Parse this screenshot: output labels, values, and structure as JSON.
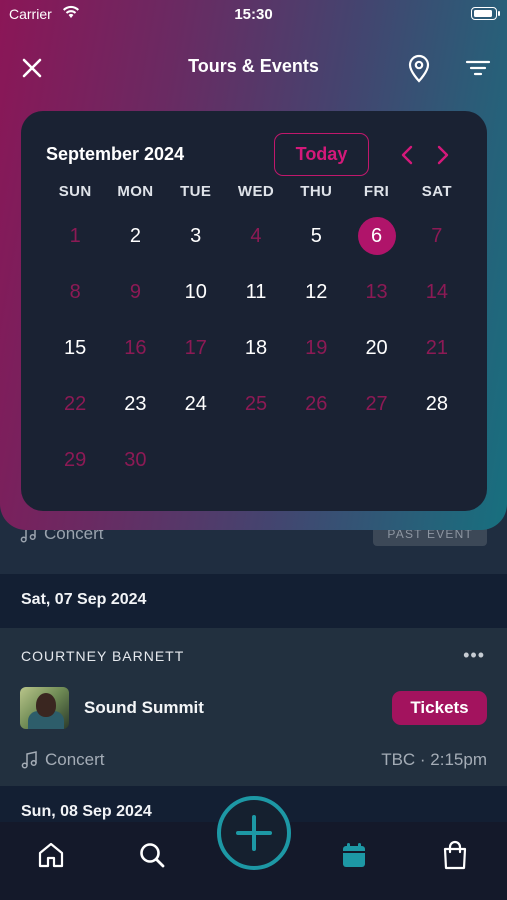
{
  "status_bar": {
    "carrier": "Carrier",
    "time": "15:30"
  },
  "nav": {
    "title": "Tours & Events"
  },
  "calendar": {
    "month_label": "September 2024",
    "today_label": "Today",
    "weekdays": [
      "SUN",
      "MON",
      "TUE",
      "WED",
      "THU",
      "FRI",
      "SAT"
    ],
    "selected_day": "6",
    "days": [
      {
        "d": "1",
        "dim": true
      },
      {
        "d": "2",
        "dim": false
      },
      {
        "d": "3",
        "dim": false
      },
      {
        "d": "4",
        "dim": true
      },
      {
        "d": "5",
        "dim": false
      },
      {
        "d": "6",
        "dim": false,
        "selected": true
      },
      {
        "d": "7",
        "dim": true
      },
      {
        "d": "8",
        "dim": true
      },
      {
        "d": "9",
        "dim": true
      },
      {
        "d": "10",
        "dim": false
      },
      {
        "d": "11",
        "dim": false
      },
      {
        "d": "12",
        "dim": false
      },
      {
        "d": "13",
        "dim": true
      },
      {
        "d": "14",
        "dim": true
      },
      {
        "d": "15",
        "dim": false
      },
      {
        "d": "16",
        "dim": true
      },
      {
        "d": "17",
        "dim": true
      },
      {
        "d": "18",
        "dim": false
      },
      {
        "d": "19",
        "dim": true
      },
      {
        "d": "20",
        "dim": false
      },
      {
        "d": "21",
        "dim": true
      },
      {
        "d": "22",
        "dim": true
      },
      {
        "d": "23",
        "dim": false
      },
      {
        "d": "24",
        "dim": false
      },
      {
        "d": "25",
        "dim": true
      },
      {
        "d": "26",
        "dim": true
      },
      {
        "d": "27",
        "dim": true
      },
      {
        "d": "28",
        "dim": false
      },
      {
        "d": "29",
        "dim": true
      },
      {
        "d": "30",
        "dim": true
      }
    ]
  },
  "list": {
    "past_row": {
      "category": "Concert",
      "badge": "PAST EVENT"
    },
    "date_header_1": "Sat, 07 Sep 2024",
    "event": {
      "artist": "COURTNEY BARNETT",
      "more": "•••",
      "title": "Sound Summit",
      "tickets_label": "Tickets",
      "category": "Concert",
      "time": "TBC · 2:15pm"
    },
    "date_header_2": "Sun, 08 Sep 2024"
  },
  "tabbar": {
    "items": [
      {
        "name": "home",
        "icon": "home-icon"
      },
      {
        "name": "search",
        "icon": "search-icon"
      },
      {
        "name": "add",
        "icon": "plus-icon"
      },
      {
        "name": "calendar",
        "icon": "calendar-icon",
        "active": true
      },
      {
        "name": "shop",
        "icon": "shopping-bag-icon"
      }
    ]
  },
  "colors": {
    "accent_magenta": "#b0146a",
    "accent_teal": "#1d98a5",
    "calendar_bg": "#1a2233"
  }
}
